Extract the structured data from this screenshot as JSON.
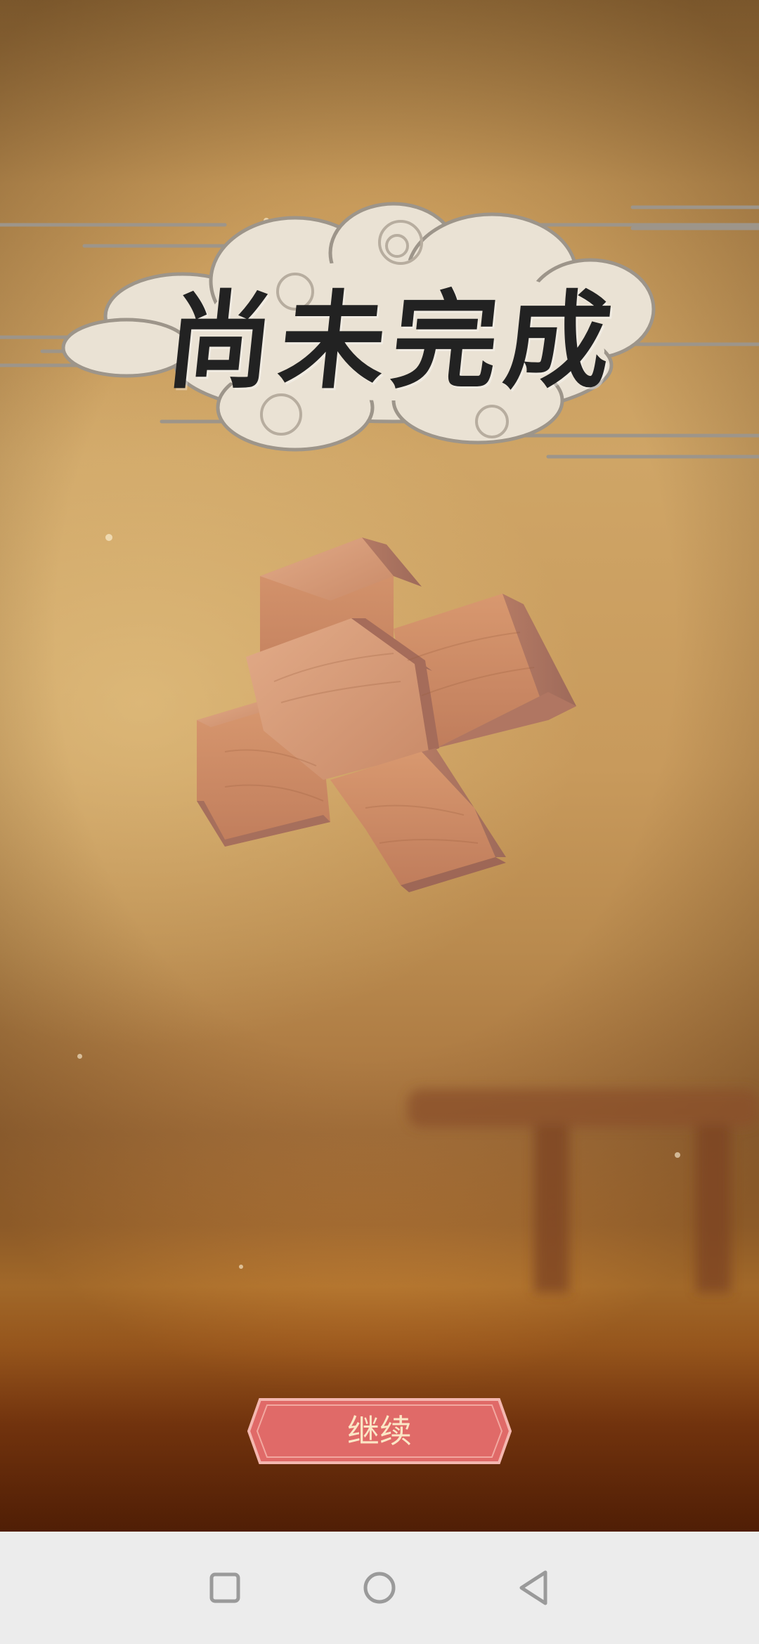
{
  "title": "尚未完成",
  "continue_button": {
    "label": "继续"
  },
  "nav": {
    "recents": "square-icon",
    "home": "circle-icon",
    "back": "triangle-back-icon"
  },
  "colors": {
    "button_fill": "#e06a68",
    "button_border": "#f4b7b0",
    "button_text": "#fbe7c6",
    "wood": "#d59a7a",
    "cloud": "#eae2d4",
    "navbar": "#ececec"
  }
}
